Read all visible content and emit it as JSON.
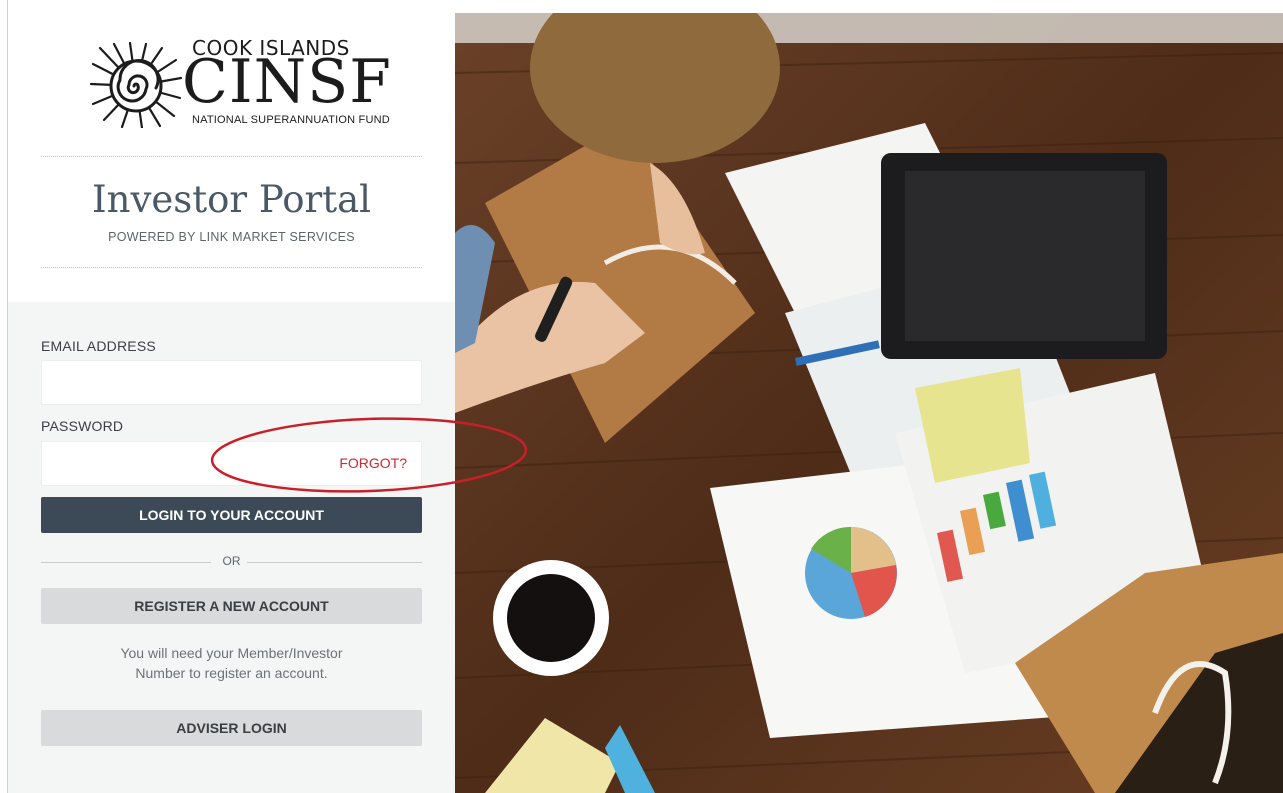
{
  "logo": {
    "top_text": "COOK ISLANDS",
    "big_text": "CINSF",
    "sub_text": "NATIONAL SUPERANNUATION FUND"
  },
  "header": {
    "title": "Investor Portal",
    "subtitle": "POWERED BY LINK MARKET SERVICES"
  },
  "form": {
    "email_label": "EMAIL ADDRESS",
    "email_value": "",
    "password_label": "PASSWORD",
    "password_value": "",
    "forgot_link": "FORGOT?",
    "login_button": "LOGIN TO YOUR ACCOUNT",
    "or_text": "OR",
    "register_button": "REGISTER A NEW ACCOUNT",
    "note_line1": "You will need your Member/Investor",
    "note_line2": "Number to register an account.",
    "adviser_button": "ADVISER LOGIN"
  },
  "colors": {
    "primary_button": "#3b4a56",
    "secondary_button": "#d9dadb",
    "forgot_link": "#d0272c",
    "annotation": "#c8202a"
  },
  "icons": [
    "nautilus-shell-logo-icon"
  ]
}
